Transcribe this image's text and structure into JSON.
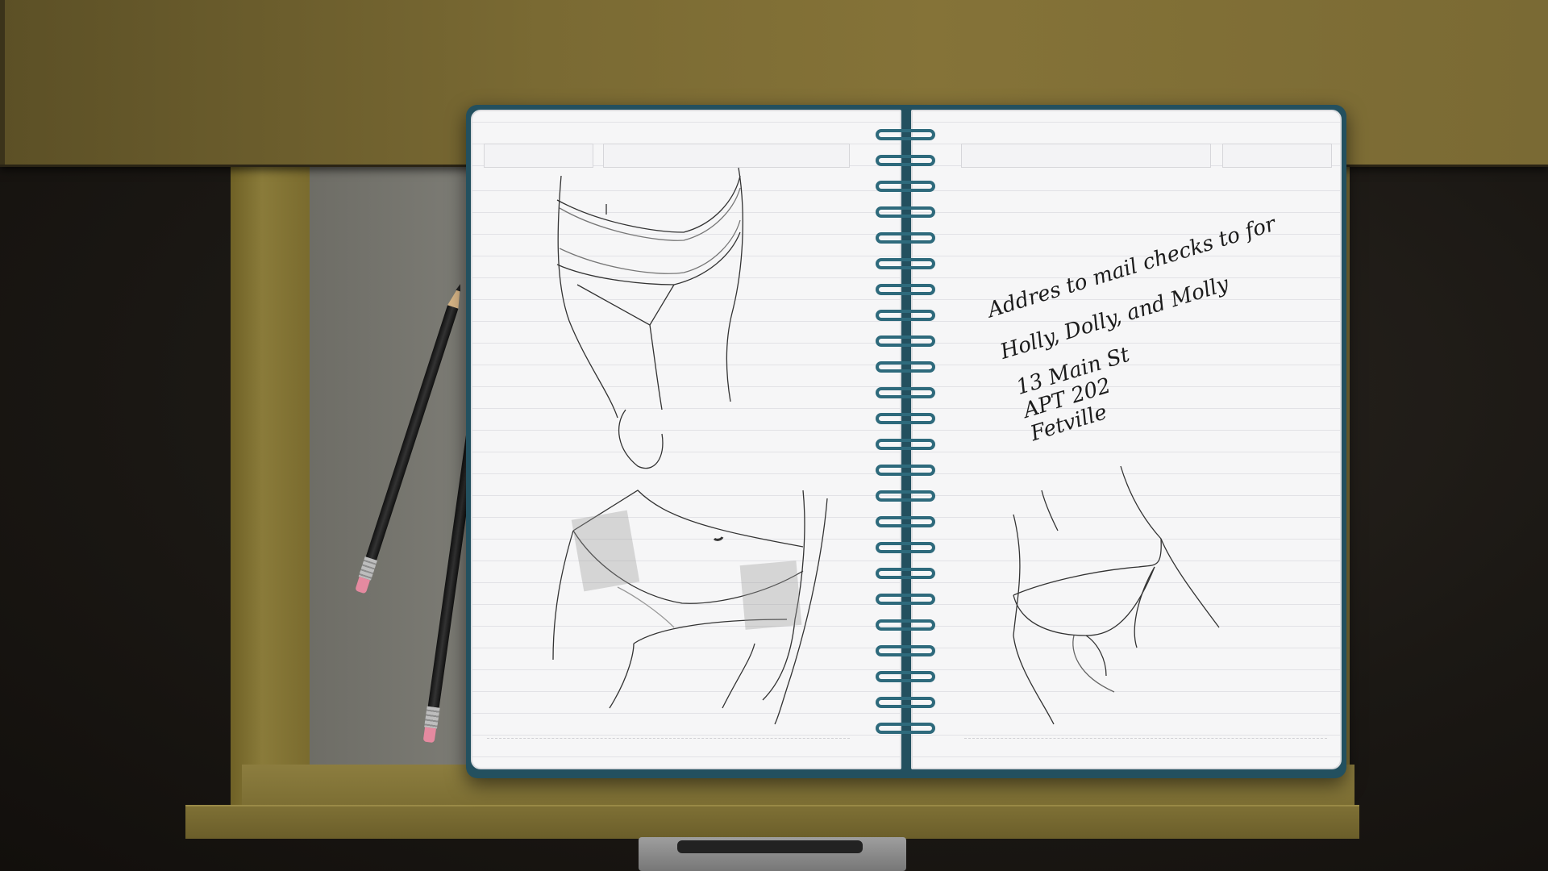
{
  "notebook": {
    "note_lines": [
      "Addres to mail checks to for",
      "Holly, Dolly, and Molly"
    ],
    "address_lines": [
      "13 Main St",
      "APT 202",
      "Fetville"
    ]
  },
  "colors": {
    "desk": "#857338",
    "notebook_cover": "#23505f",
    "spiral": "#2e6a7c",
    "page": "#f6f6f7",
    "eraser": "#e58aa0"
  },
  "icons": [
    "pencil-icon",
    "notebook-icon",
    "drawer-handle-icon"
  ]
}
